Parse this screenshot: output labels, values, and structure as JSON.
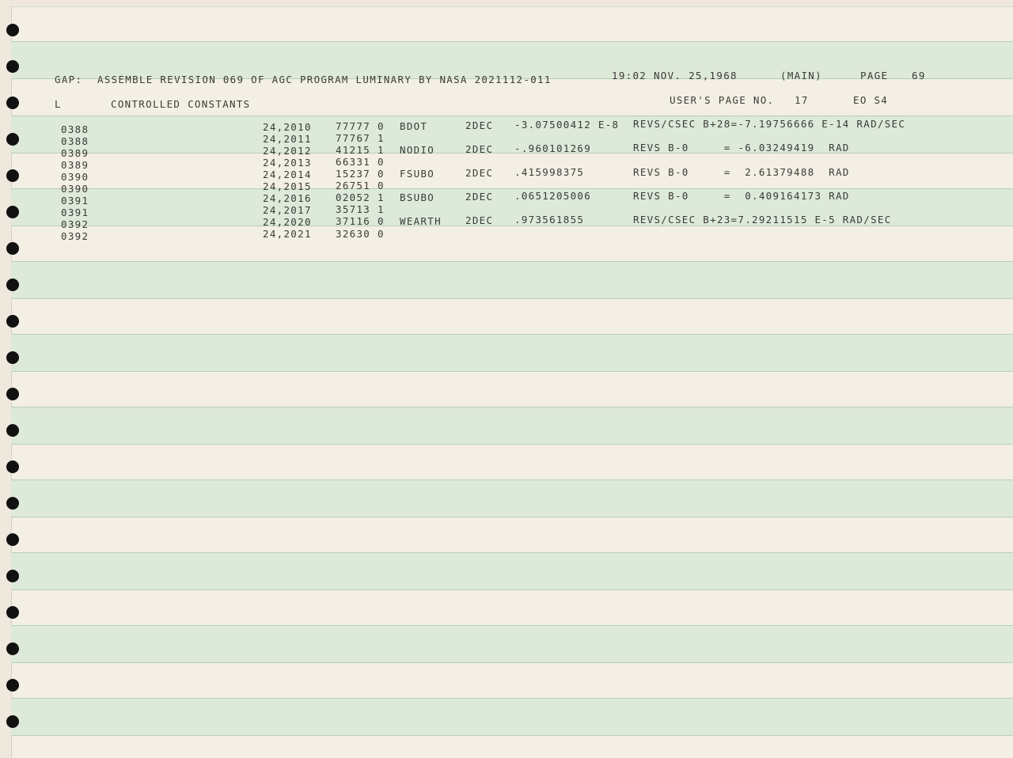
{
  "header": {
    "gap_label": "GAP:",
    "assemble_line": "ASSEMBLE REVISION 069 OF AGC PROGRAM LUMINARY BY NASA 2021112-011",
    "timestamp": "19:02 NOV. 25,1968",
    "section": "(MAIN)",
    "page_label": "PAGE",
    "page_number": "69"
  },
  "subheader": {
    "l_marker": "L",
    "title": "CONTROLLED CONSTANTS",
    "users_page_label": "USER'S PAGE NO.",
    "users_page_number": "17",
    "eo": "EO S4"
  },
  "listing": [
    {
      "line": "0388",
      "addr": "24,2010",
      "word": "77777 0",
      "label": "BDOT",
      "op": "2DEC",
      "value": "-3.07500412 E-8",
      "unit": "REVS/CSEC B+28=-7.19756666 E-14 RAD/SEC"
    },
    {
      "line": "0388",
      "addr": "24,2011",
      "word": "77767 1",
      "label": "",
      "op": "",
      "value": "",
      "unit": ""
    },
    {
      "line": "0389",
      "addr": "24,2012",
      "word": "41215 1",
      "label": "NODIO",
      "op": "2DEC",
      "value": "-.960101269",
      "unit": "REVS B-0     = -6.03249419  RAD"
    },
    {
      "line": "0389",
      "addr": "24,2013",
      "word": "66331 0",
      "label": "",
      "op": "",
      "value": "",
      "unit": ""
    },
    {
      "line": "0390",
      "addr": "24,2014",
      "word": "15237 0",
      "label": "FSUBO",
      "op": "2DEC",
      "value": ".415998375",
      "unit": "REVS B-0     =  2.61379488  RAD"
    },
    {
      "line": "0390",
      "addr": "24,2015",
      "word": "26751 0",
      "label": "",
      "op": "",
      "value": "",
      "unit": ""
    },
    {
      "line": "0391",
      "addr": "24,2016",
      "word": "02052 1",
      "label": "BSUBO",
      "op": "2DEC",
      "value": ".0651205006",
      "unit": "REVS B-0     =  0.409164173 RAD"
    },
    {
      "line": "0391",
      "addr": "24,2017",
      "word": "35713 1",
      "label": "",
      "op": "",
      "value": "",
      "unit": ""
    },
    {
      "line": "0392",
      "addr": "24,2020",
      "word": "37116 0",
      "label": "WEARTH",
      "op": "2DEC",
      "value": ".973561855",
      "unit": "REVS/CSEC B+23=7.29211515 E-5 RAD/SEC"
    },
    {
      "line": "0392",
      "addr": "24,2021",
      "word": "32630 0",
      "label": "",
      "op": "",
      "value": "",
      "unit": ""
    }
  ]
}
